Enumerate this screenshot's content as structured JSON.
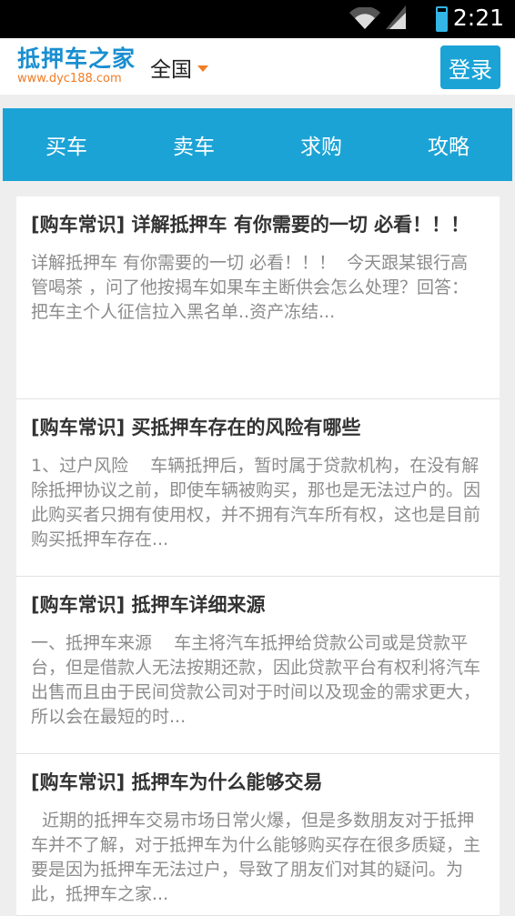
{
  "status_bar": {
    "time": "2:21",
    "icons": [
      "wifi-icon",
      "signal-icon",
      "battery-icon"
    ],
    "battery_level_percent": 85
  },
  "header": {
    "logo_title": "抵押车之家",
    "logo_url": "www.dyc188.com",
    "region": "全国",
    "login_label": "登录"
  },
  "nav": {
    "items": [
      {
        "label": "买车"
      },
      {
        "label": "卖车"
      },
      {
        "label": "求购"
      },
      {
        "label": "攻略"
      }
    ]
  },
  "articles": [
    {
      "title": "[购车常识]  详解抵押车 有你需要的一切 必看！！！",
      "summary": "详解抵押车 有你需要的一切 必看！！！  今天跟某银行高管喝茶 ，问了他按揭车如果车主断供会怎么处理？回答：把车主个人征信拉入黑名单..资产冻结..."
    },
    {
      "title": "[购车常识]  买抵押车存在的风险有哪些",
      "summary": "1、过户风险    车辆抵押后，暂时属于贷款机构，在没有解除抵押协议之前，即使车辆被购买，那也是无法过户的。因此购买者只拥有使用权，并不拥有汽车所有权，这也是目前购买抵押车存在..."
    },
    {
      "title": "[购车常识]  抵押车详细来源",
      "summary": "一、抵押车来源    车主将汽车抵押给贷款公司或是贷款平台，但是借款人无法按期还款，因此贷款平台有权利将汽车出售而且由于民间贷款公司对于时间以及现金的需求更大，所以会在最短的时..."
    },
    {
      "title": "[购车常识]  抵押车为什么能够交易",
      "summary": "  近期的抵押车交易市场日常火爆，但是多数朋友对于抵押车并不了解，对于抵押车为什么能够购买存在很多质疑，主要是因为抵押车无法过户，导致了朋友们对其的疑问。为此，抵押车之家..."
    }
  ],
  "colors": {
    "brand_blue": "#1ba3d6",
    "logo_orange": "#f27c24"
  }
}
